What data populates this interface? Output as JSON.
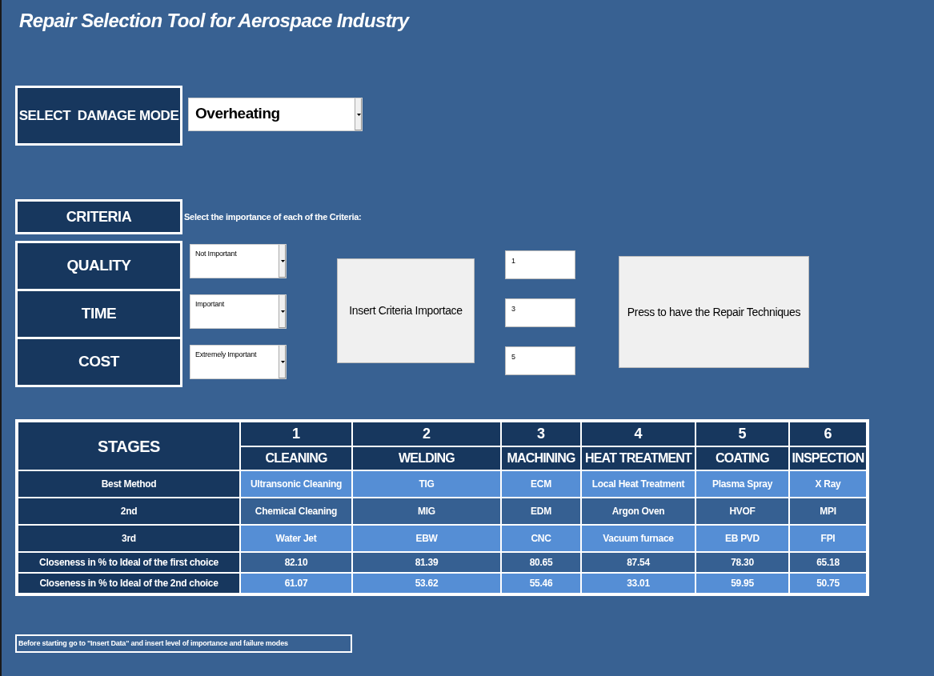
{
  "title": "Repair Selection Tool for Aerospace Industry",
  "damage_mode": {
    "label": "SELECT  DAMAGE MODE",
    "value": "Overheating"
  },
  "criteria": {
    "label": "CRITERIA",
    "instruction": "Select the importance of each of the Criteria:",
    "items": [
      {
        "name": "QUALITY",
        "importance": "Not Important",
        "score": "1"
      },
      {
        "name": "TIME",
        "importance": "Important",
        "score": "3"
      },
      {
        "name": "COST",
        "importance": "Extremely Important",
        "score": "5"
      }
    ]
  },
  "buttons": {
    "insert": "Insert Criteria Importace",
    "press": "Press to have the Repair Techniques"
  },
  "table": {
    "corner": "STAGES",
    "columns": [
      {
        "number": "1",
        "name": "CLEANING"
      },
      {
        "number": "2",
        "name": "WELDING"
      },
      {
        "number": "3",
        "name": "MACHINING"
      },
      {
        "number": "4",
        "name": "HEAT TREATMENT"
      },
      {
        "number": "5",
        "name": "COATING"
      },
      {
        "number": "6",
        "name": "INSPECTION"
      }
    ],
    "rows": [
      {
        "label": "Best Method",
        "kind": "method",
        "cells": [
          "Ultransonic Cleaning",
          "TIG",
          "ECM",
          "Local Heat Treatment",
          "Plasma Spray",
          "X Ray"
        ]
      },
      {
        "label": "2nd",
        "kind": "method",
        "cells": [
          "Chemical Cleaning",
          "MIG",
          "EDM",
          "Argon Oven",
          "HVOF",
          "MPI"
        ]
      },
      {
        "label": "3rd",
        "kind": "method",
        "cells": [
          "Water Jet",
          "EBW",
          "CNC",
          "Vacuum furnace",
          "EB PVD",
          "FPI"
        ]
      },
      {
        "label": "Closeness in % to Ideal of the first choice",
        "kind": "score",
        "cells": [
          "82.10",
          "81.39",
          "80.65",
          "87.54",
          "78.30",
          "65.18"
        ]
      },
      {
        "label": "Closeness in % to Ideal of the 2nd choice",
        "kind": "score",
        "cells": [
          "61.07",
          "53.62",
          "55.46",
          "33.01",
          "59.95",
          "50.75"
        ]
      }
    ]
  },
  "note": "Before starting go to \"Insert Data\" and insert level of importance and failure modes"
}
